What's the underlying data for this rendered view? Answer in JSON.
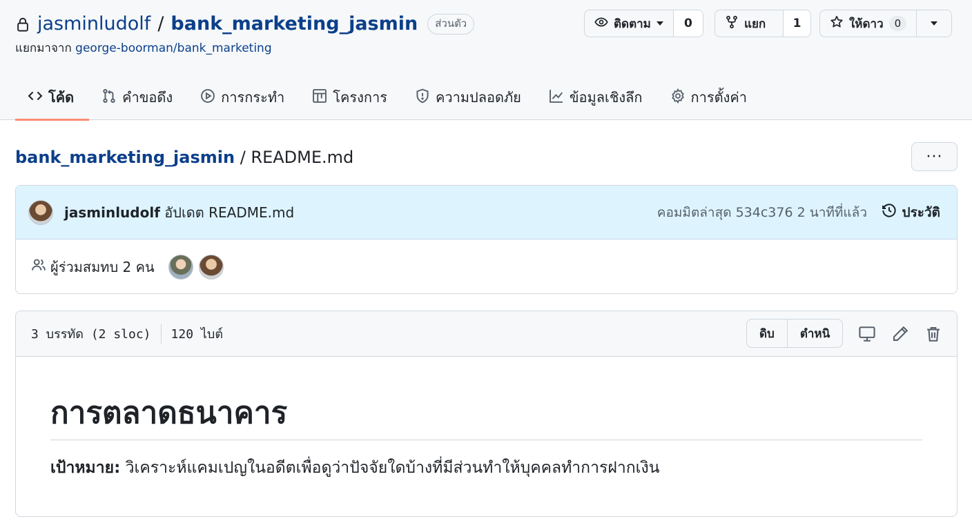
{
  "repo": {
    "owner": "jasminludolf",
    "separator": "/",
    "name": "bank_marketing_jasmin",
    "visibility_badge": "ส่วนตัว",
    "fork_prefix": "แยกมาจาก",
    "fork_source": "george-boorman/bank_marketing"
  },
  "actions": {
    "watch": {
      "label": "ติดตาม",
      "count": "0",
      "icon": "eye-icon"
    },
    "fork": {
      "label": "แยก",
      "count": "1",
      "icon": "repo-forked-icon"
    },
    "star": {
      "label": "ให้ดาว",
      "count": "0",
      "icon": "star-icon"
    }
  },
  "tabs": [
    {
      "label": "โค้ด",
      "icon": "code-icon",
      "active": true
    },
    {
      "label": "คำขอดึง",
      "icon": "git-pull-request-icon"
    },
    {
      "label": "การกระทำ",
      "icon": "play-icon"
    },
    {
      "label": "โครงการ",
      "icon": "table-icon"
    },
    {
      "label": "ความปลอดภัย",
      "icon": "shield-icon"
    },
    {
      "label": "ข้อมูลเชิงลึก",
      "icon": "graph-icon"
    },
    {
      "label": "การตั้งค่า",
      "icon": "gear-icon"
    }
  ],
  "breadcrumb": {
    "repo": "bank_marketing_jasmin",
    "separator": "/",
    "file": "README.md"
  },
  "more_label": "···",
  "commit": {
    "author": "jasminludolf",
    "message": "อัปเดต README.md",
    "meta": "คอมมิตล่าสุด 534c376 2 นาทีที่แล้ว",
    "history_label": "ประวัติ"
  },
  "contributors": {
    "label": "ผู้ร่วมสมทบ 2 คน"
  },
  "file": {
    "lines": "3 บรรทัด (2 sloc)",
    "size": "120 ไบต์",
    "raw_label": "ดิบ",
    "blame_label": "ตำหนิ"
  },
  "readme": {
    "heading": "การตลาดธนาคาร",
    "goal_label": "เป้าหมาย:",
    "goal_text": " วิเคราะห์แคมเปญในอดีตเพื่อดูว่าปัจจัยใดบ้างที่มีส่วนทำให้บุคคลทำการฝากเงิน"
  },
  "colors": {
    "link": "#0b3f8a",
    "active_tab": "#fd8c73",
    "commit_bg": "#ddf4ff"
  }
}
